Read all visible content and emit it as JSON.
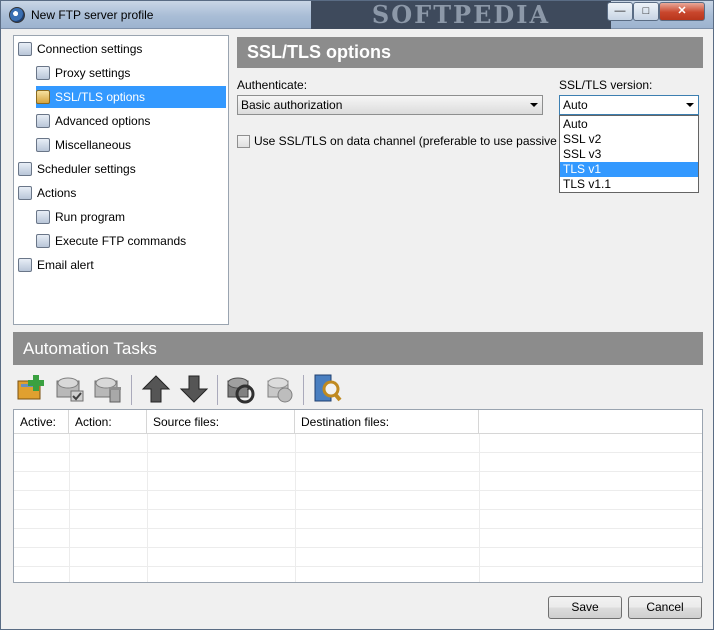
{
  "window": {
    "title": "New FTP server profile",
    "watermark": "SOFTPEDIA",
    "controls": {
      "minimize": "—",
      "maximize": "□",
      "close": "✕"
    }
  },
  "tree": {
    "items": [
      {
        "label": "Connection settings",
        "icon": "connection-icon",
        "level": 0
      },
      {
        "label": "Proxy settings",
        "icon": "proxy-icon",
        "level": 1
      },
      {
        "label": "SSL/TLS options",
        "icon": "lock-icon",
        "level": 1,
        "selected": true
      },
      {
        "label": "Advanced options",
        "icon": "advanced-icon",
        "level": 1
      },
      {
        "label": "Miscellaneous",
        "icon": "gears-icon",
        "level": 1
      },
      {
        "label": "Scheduler settings",
        "icon": "clock-icon",
        "level": 0
      },
      {
        "label": "Actions",
        "icon": "actions-icon",
        "level": 0
      },
      {
        "label": "Run program",
        "icon": "run-icon",
        "level": 1
      },
      {
        "label": "Execute FTP commands",
        "icon": "ftp-commands-icon",
        "level": 1
      },
      {
        "label": "Email alert",
        "icon": "email-icon",
        "level": 0
      }
    ]
  },
  "ssl": {
    "title": "SSL/TLS options",
    "authenticate_label": "Authenticate:",
    "authenticate_value": "Basic authorization",
    "version_label": "SSL/TLS version:",
    "version_value": "Auto",
    "version_options": [
      "Auto",
      "SSL v2",
      "SSL v3",
      "TLS v1",
      "TLS v1.1"
    ],
    "version_highlighted": "TLS v1",
    "data_channel_label": "Use SSL/TLS on data channel (preferable to use passive mo",
    "data_channel_checked": false
  },
  "automation": {
    "title": "Automation Tasks",
    "toolbar": [
      "add-task-icon",
      "edit-task-icon",
      "delete-task-icon",
      "move-up-icon",
      "move-down-icon",
      "run-task-icon",
      "stop-task-icon",
      "preview-icon"
    ],
    "columns": [
      "Active:",
      "Action:",
      "Source files:",
      "Destination files:"
    ]
  },
  "buttons": {
    "save": "Save",
    "cancel": "Cancel"
  },
  "colors": {
    "selection": "#3399ff",
    "header_bg": "#8c8c8c",
    "dialog_bg": "#f0f0f0"
  }
}
